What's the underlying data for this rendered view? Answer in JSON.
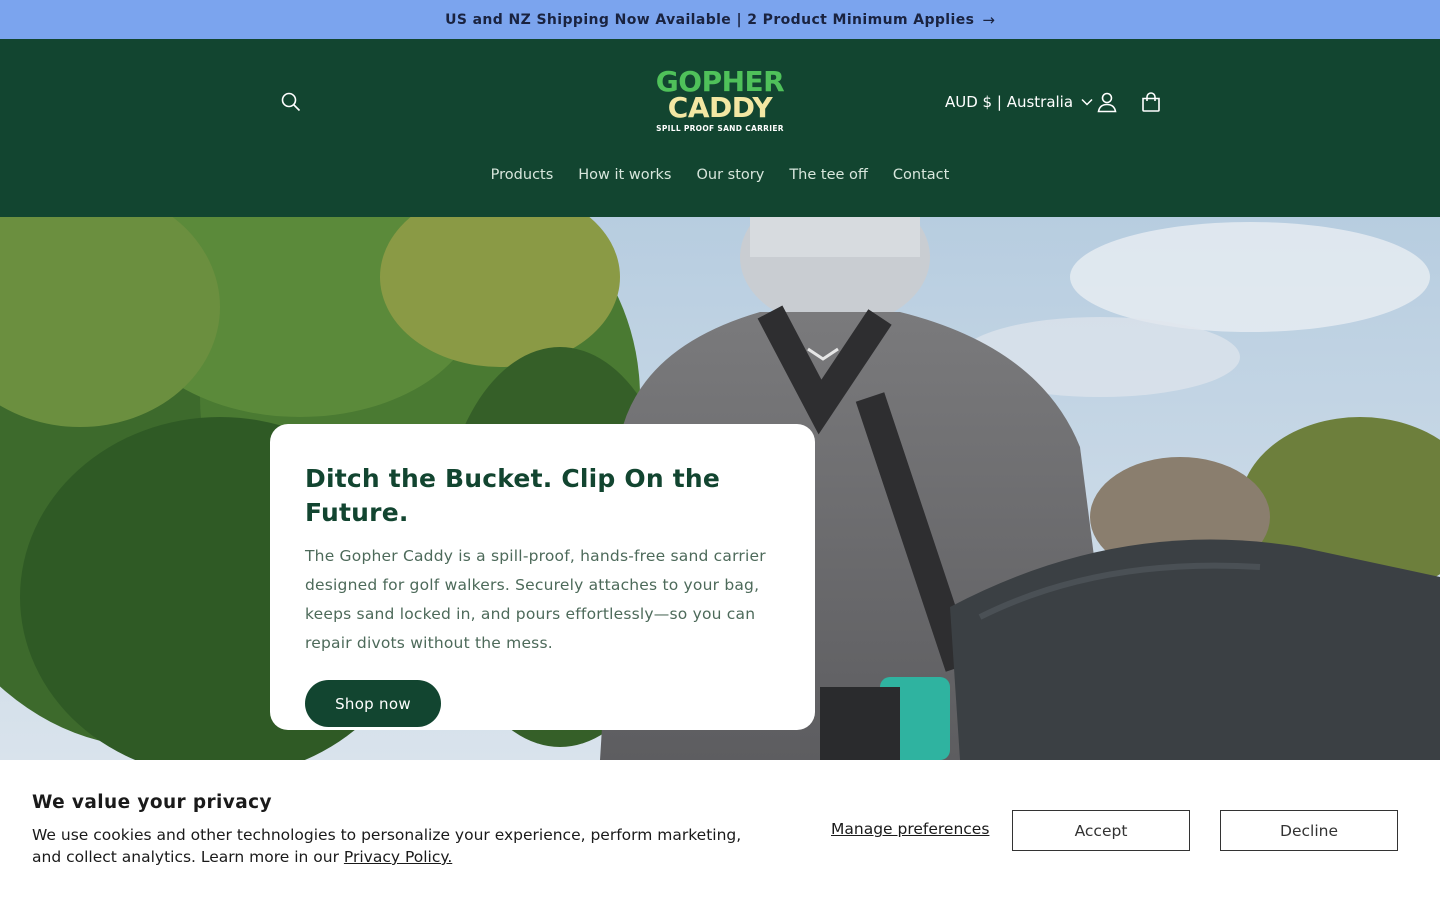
{
  "announcement": {
    "text": "US and NZ Shipping Now Available | 2 Product Minimum Applies",
    "arrow": "→"
  },
  "header": {
    "logo": {
      "line1": "GOPHER",
      "line2": "CADDY",
      "line3": "SPILL PROOF SAND CARRIER"
    },
    "currency": "AUD $ | Australia",
    "icons": {
      "search": "search-icon",
      "account": "user-icon",
      "cart": "cart-icon",
      "chevron": "chevron-down-icon"
    }
  },
  "nav": {
    "items": [
      {
        "label": "Products"
      },
      {
        "label": "How it works"
      },
      {
        "label": "Our story"
      },
      {
        "label": "The tee off"
      },
      {
        "label": "Contact"
      }
    ]
  },
  "hero": {
    "title": "Ditch the Bucket. Clip On the Future.",
    "description": "The Gopher Caddy is a spill-proof, hands-free sand carrier designed for golf walkers. Securely attaches to your bag, keeps sand locked in, and pours effortlessly—so you can repair divots without the mess.",
    "cta": "Shop now"
  },
  "cookie": {
    "title": "We value your privacy",
    "description": "We use cookies and other technologies to personalize your experience, perform marketing, and collect analytics. Learn more in our ",
    "privacy_link": "Privacy Policy.",
    "manage": "Manage preferences",
    "accept": "Accept",
    "decline": "Decline"
  },
  "colors": {
    "brand_green": "#124530",
    "announcement_bg": "#7ba4ee",
    "logo_green": "#4fc15a",
    "logo_cream": "#f3e7a3"
  }
}
